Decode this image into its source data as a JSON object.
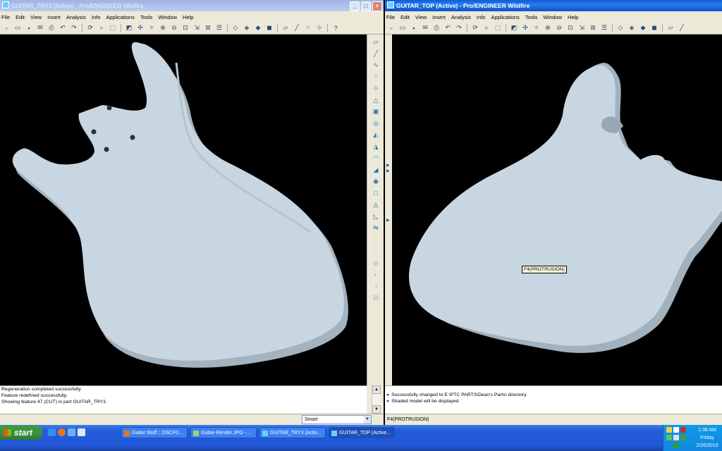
{
  "left_window": {
    "title": "GUITAR_TRY3 (Active) - Pro/ENGINEER Wildfire",
    "menu": [
      "File",
      "Edit",
      "View",
      "Insert",
      "Analysis",
      "Info",
      "Applications",
      "Tools",
      "Window",
      "Help"
    ],
    "messages": [
      "Regeneration completed successfully.",
      "Feature redefined successfully.",
      "Showing feature 47 (CUT) in part GUITAR_TRY3."
    ],
    "filter_value": "Smart"
  },
  "right_window": {
    "title": "GUITAR_TOP (Active) - Pro/ENGINEER Wildfire",
    "menu": [
      "File",
      "Edit",
      "View",
      "Insert",
      "Analysis",
      "Info",
      "Applications",
      "Tools",
      "Window",
      "Help"
    ],
    "messages": [
      "Successfully changed to E:\\PTC PARTS\\Dean's Parts\\ directory.",
      "Shaded model will be displayed"
    ],
    "status": "F4(PROTRUSION)",
    "feature_tag": "F4(PROTRUSION)"
  },
  "taskbar": {
    "start_label": "start",
    "tasks": [
      {
        "label": "Guitar Stuff :: DSCF0..."
      },
      {
        "label": "Guitar-Render.JPG - ..."
      },
      {
        "label": "GUITAR_TRY3 (Activ..."
      },
      {
        "label": "GUITAR_TOP (Active..."
      }
    ],
    "clock_time": "1:38 AM",
    "clock_day": "Friday",
    "clock_date": "2/26/2010"
  },
  "colors": {
    "model_fill": "#c7d6e2",
    "model_side": "#a7b7c3",
    "viewport_bg": "#000000",
    "xp_taskbar": "#245edb",
    "start_green": "#3f8f3e"
  }
}
